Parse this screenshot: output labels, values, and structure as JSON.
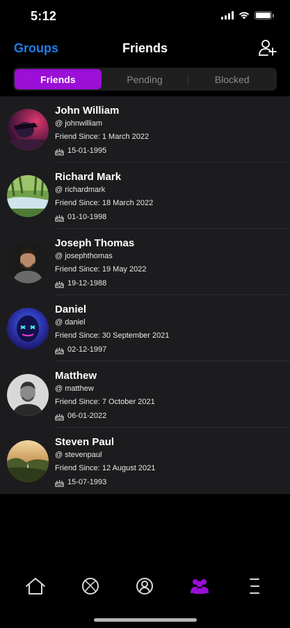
{
  "status": {
    "time": "5:12"
  },
  "nav": {
    "left": "Groups",
    "title": "Friends"
  },
  "segments": [
    {
      "label": "Friends",
      "active": true
    },
    {
      "label": "Pending",
      "active": false
    },
    {
      "label": "Blocked",
      "active": false
    }
  ],
  "friends": [
    {
      "name": "John William",
      "handle": "@ johnwilliam",
      "since": "Friend Since: 1 March 2022",
      "birthday": "15-01-1995"
    },
    {
      "name": "Richard Mark",
      "handle": "@ richardmark",
      "since": "Friend Since: 18 March 2022",
      "birthday": "01-10-1998"
    },
    {
      "name": "Joseph Thomas",
      "handle": "@ josephthomas",
      "since": "Friend Since: 19 May 2022",
      "birthday": "19-12-1988"
    },
    {
      "name": "Daniel",
      "handle": "@ daniel",
      "since": "Friend Since: 30 September 2021",
      "birthday": "02-12-1997"
    },
    {
      "name": "Matthew",
      "handle": "@ matthew",
      "since": "Friend Since: 7 October 2021",
      "birthday": "06-01-2022"
    },
    {
      "name": "Steven Paul",
      "handle": "@ stevenpaul",
      "since": "Friend Since: 12 August 2021",
      "birthday": "15-07-1993"
    }
  ],
  "tabbar": [
    {
      "icon": "home-icon",
      "active": false
    },
    {
      "icon": "sports-ball-icon",
      "active": false
    },
    {
      "icon": "profile-icon",
      "active": false
    },
    {
      "icon": "friends-icon",
      "active": true
    },
    {
      "icon": "menu-icon",
      "active": false
    }
  ],
  "colors": {
    "accent": "#9b0fd6",
    "link": "#1e7de6",
    "background": "#000000",
    "list_background": "#1c1c1e"
  }
}
